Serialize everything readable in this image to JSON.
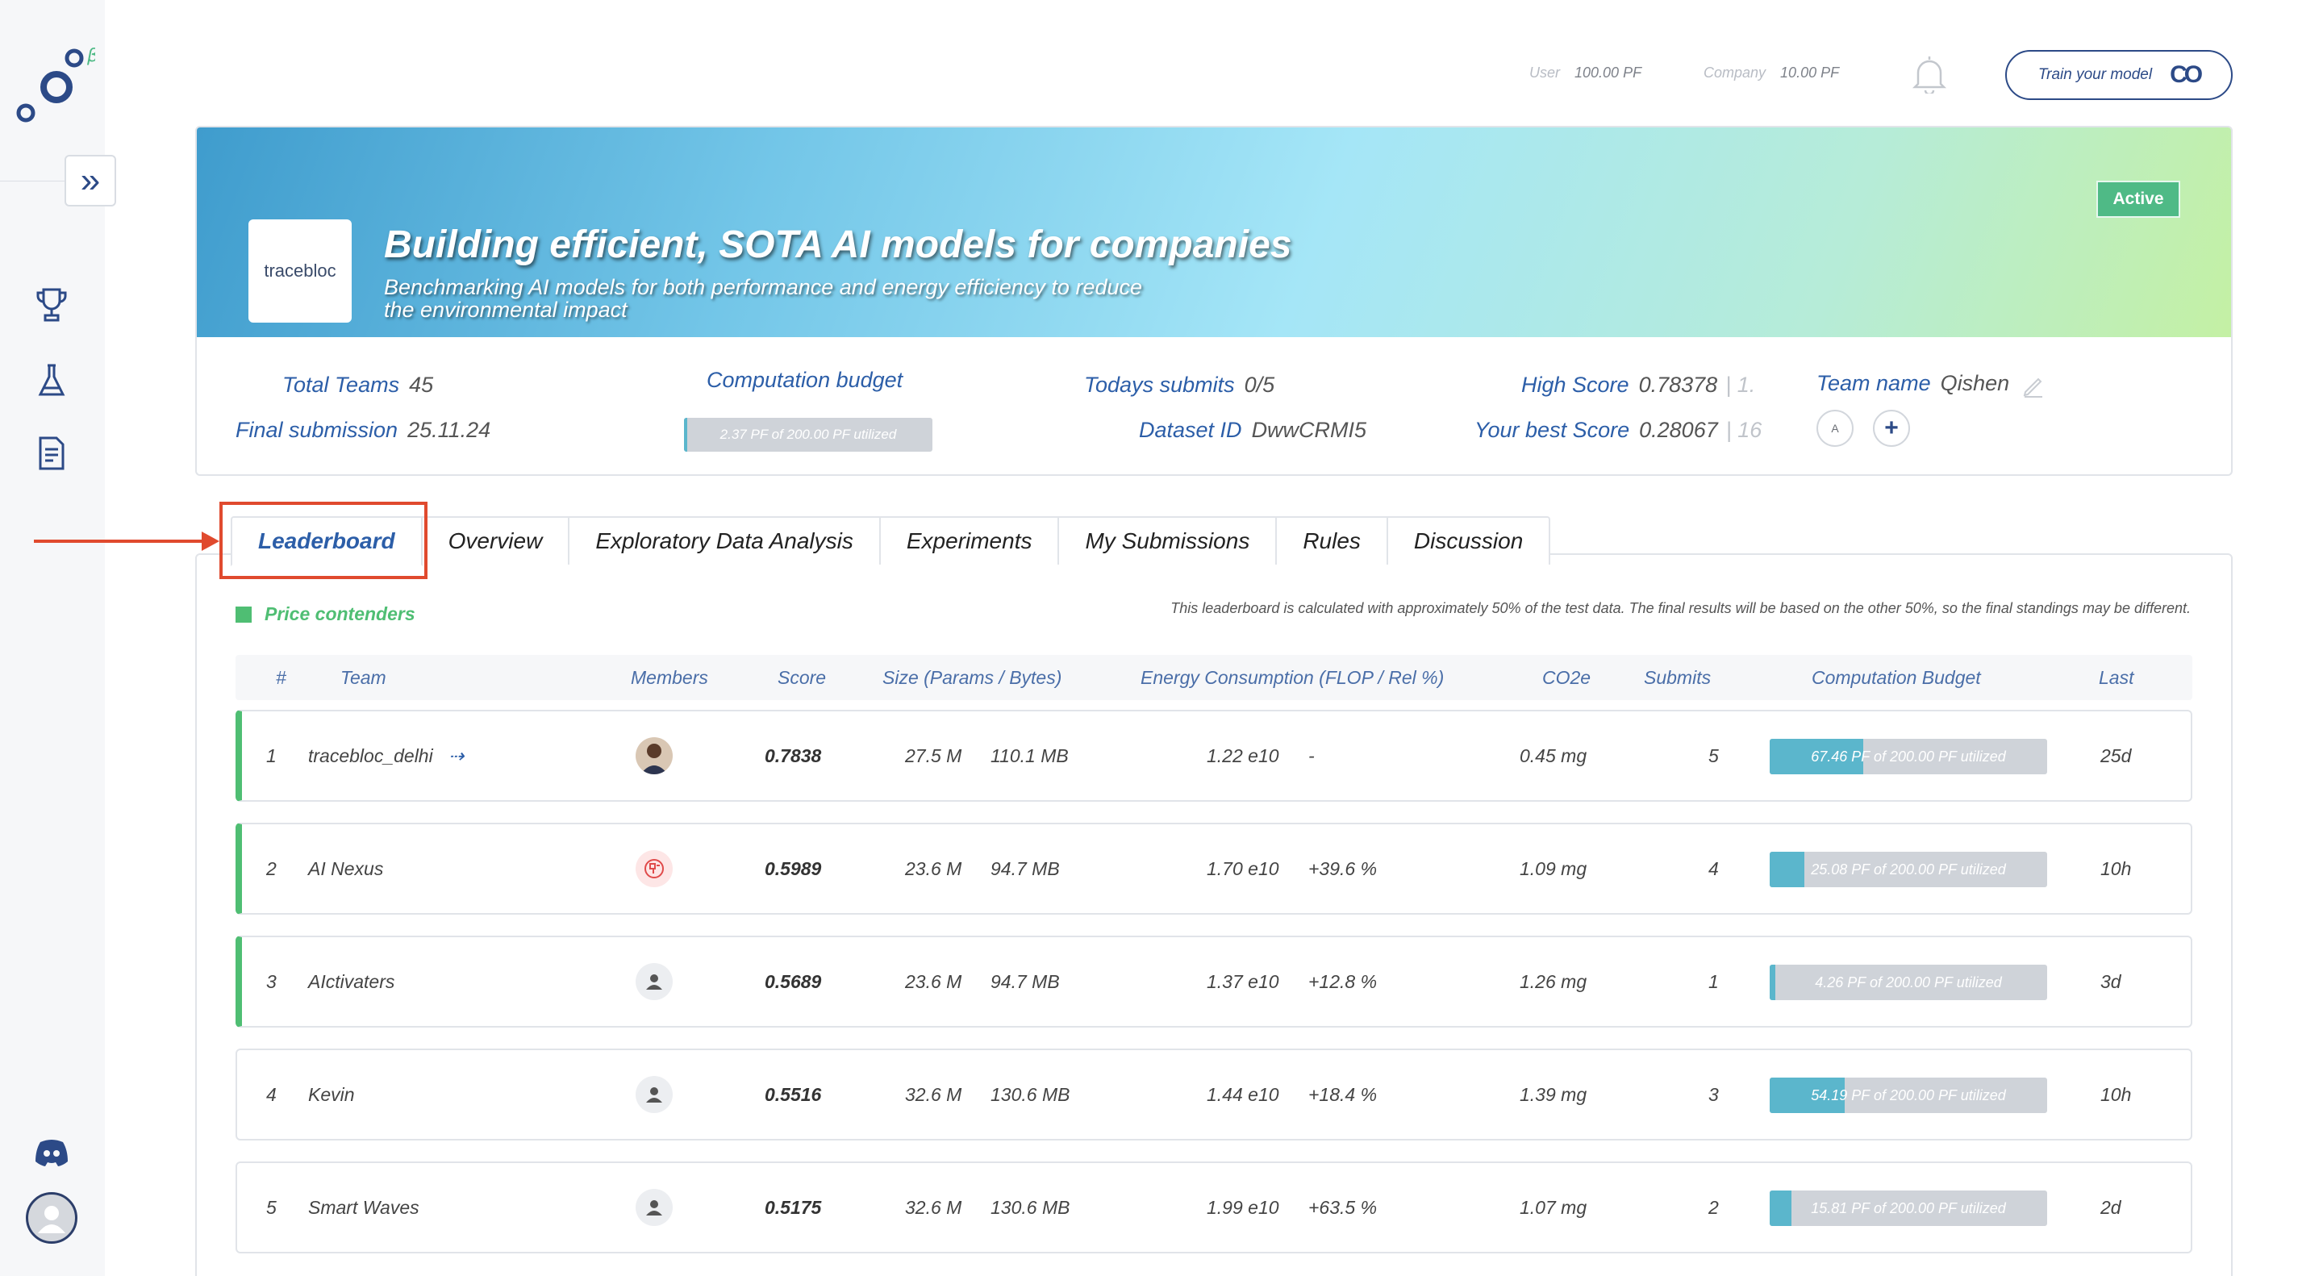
{
  "sidebar": {
    "logo_superscript": "β",
    "nav_icons": [
      "trophy-icon",
      "flask-icon",
      "document-icon",
      "discord-icon",
      "user-avatar-icon"
    ]
  },
  "topbar": {
    "user_label": "User",
    "user_value": "100.00 PF",
    "company_label": "Company",
    "company_value": "10.00 PF",
    "train_button": "Train your model",
    "train_logo": "CO"
  },
  "competition": {
    "logo_text": "tracebloc",
    "title": "Building efficient, SOTA AI models for companies",
    "subtitle": "Benchmarking AI models for both performance and energy efficiency to reduce the environmental impact",
    "status": "Active",
    "total_teams_label": "Total Teams",
    "total_teams": "45",
    "final_submission_label": "Final submission",
    "final_submission": "25.11.24",
    "computation_budget_label": "Computation budget",
    "computation_budget_text": "2.37 PF of 200.00 PF utilized",
    "computation_budget_fraction": 0.012,
    "todays_submits_label": "Todays submits",
    "todays_submits": "0/5",
    "dataset_id_label": "Dataset ID",
    "dataset_id": "DwwCRMI5",
    "high_score_label": "High Score",
    "high_score": "0.78378",
    "high_score_rank": "| 1.",
    "best_score_label": "Your best Score",
    "best_score": "0.28067",
    "best_score_rank": "| 16",
    "team_name_label": "Team name",
    "team_name": "Qishen",
    "team_member_initial": "A",
    "add_member": "+"
  },
  "tabs": [
    "Leaderboard",
    "Overview",
    "Exploratory Data Analysis",
    "Experiments",
    "My Submissions",
    "Rules",
    "Discussion"
  ],
  "leaderboard": {
    "legend": "Price contenders",
    "note": "This leaderboard is calculated with approximately 50% of the test data. The final results will be based on the other 50%, so the final standings may be different.",
    "columns": [
      "#",
      "Team",
      "Members",
      "Score",
      "Size (Params / Bytes)",
      "Energy Consumption (FLOP / Rel %)",
      "CO2e",
      "Submits",
      "Computation Budget",
      "Last"
    ],
    "rows": [
      {
        "rank": "1",
        "team": "tracebloc_delhi",
        "link_icon": "⇢",
        "score": "0.7838",
        "params": "27.5 M",
        "bytes": "110.1 MB",
        "flop": "1.22 e10",
        "rel": "-",
        "co2": "0.45 mg",
        "submits": "5",
        "budget": "67.46 PF of 200.00 PF utilized",
        "budget_fraction": 0.337,
        "last": "25d"
      },
      {
        "rank": "2",
        "team": "AI Nexus",
        "link_icon": "",
        "score": "0.5989",
        "params": "23.6 M",
        "bytes": "94.7 MB",
        "flop": "1.70 e10",
        "rel": "+39.6 %",
        "co2": "1.09 mg",
        "submits": "4",
        "budget": "25.08 PF of 200.00 PF utilized",
        "budget_fraction": 0.125,
        "last": "10h"
      },
      {
        "rank": "3",
        "team": "AIctivaters",
        "link_icon": "",
        "score": "0.5689",
        "params": "23.6 M",
        "bytes": "94.7 MB",
        "flop": "1.37 e10",
        "rel": "+12.8 %",
        "co2": "1.26 mg",
        "submits": "1",
        "budget": "4.26 PF of 200.00 PF utilized",
        "budget_fraction": 0.021,
        "last": "3d"
      },
      {
        "rank": "4",
        "team": "Kevin",
        "link_icon": "",
        "score": "0.5516",
        "params": "32.6 M",
        "bytes": "130.6 MB",
        "flop": "1.44 e10",
        "rel": "+18.4 %",
        "co2": "1.39 mg",
        "submits": "3",
        "budget": "54.19 PF of 200.00 PF utilized",
        "budget_fraction": 0.271,
        "last": "10h"
      },
      {
        "rank": "5",
        "team": "Smart Waves",
        "link_icon": "",
        "score": "0.5175",
        "params": "32.6 M",
        "bytes": "130.6 MB",
        "flop": "1.99 e10",
        "rel": "+63.5 %",
        "co2": "1.07 mg",
        "submits": "2",
        "budget": "15.81 PF of 200.00 PF utilized",
        "budget_fraction": 0.079,
        "last": "2d"
      }
    ]
  },
  "colors": {
    "brand_blue": "#2c5ea8",
    "contender_green": "#4fbe73",
    "active_green": "#4fba86",
    "budget_fill": "#5bb6cc",
    "highlight_red": "#e04a2e"
  }
}
